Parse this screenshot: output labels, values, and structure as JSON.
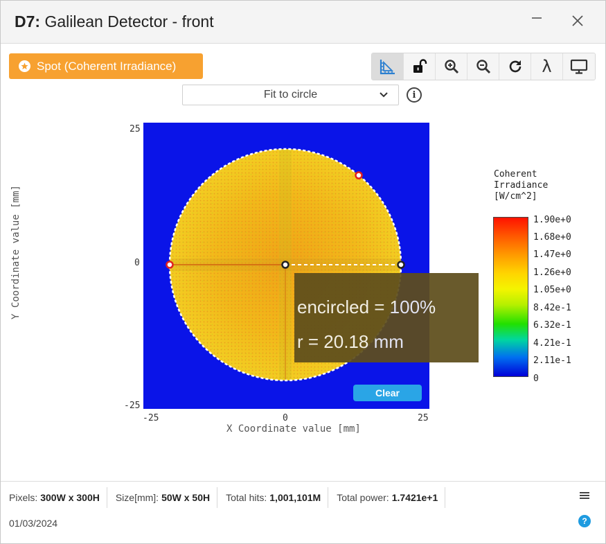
{
  "window": {
    "title_bold": "D7:",
    "title_rest": " Galilean Detector - front"
  },
  "header": {
    "spot_button_label": "Spot (Coherent Irradiance)"
  },
  "toolbar": {
    "icons": [
      "ruler-icon",
      "unlock-icon",
      "zoom-in-icon",
      "zoom-out-icon",
      "refresh-icon",
      "lambda-icon",
      "monitor-icon"
    ],
    "lambda_glyph": "λ"
  },
  "fit": {
    "selected": "Fit to circle",
    "info_glyph": "i"
  },
  "plot": {
    "y_axis_label": "Y Coordinate value [mm]",
    "x_axis_label": "X Coordinate value [mm]",
    "y_ticks": [
      "25",
      "0",
      "-25"
    ],
    "x_ticks": [
      "-25",
      "0",
      "25"
    ],
    "clear_label": "Clear",
    "tooltip_line1": "encircled = 100%",
    "tooltip_line2": "r = 20.18 mm",
    "colors": {
      "background": "#0a14e8",
      "spot": "#f2c11a",
      "accent": "#f7a130"
    }
  },
  "colorbar": {
    "title": "Coherent\nIrradiance\n[W/cm^2]",
    "ticks": [
      "1.90e+0",
      "1.68e+0",
      "1.47e+0",
      "1.26e+0",
      "1.05e+0",
      "8.42e-1",
      "6.32e-1",
      "4.21e-1",
      "2.11e-1",
      "0"
    ]
  },
  "footer": {
    "pixels_label": "Pixels:",
    "pixels_value": "300W x 300H",
    "size_label": "Size[mm]:",
    "size_value": "50W x 50H",
    "hits_label": "Total hits:",
    "hits_value": "1,001,101M",
    "power_label": "Total power:",
    "power_value": "1.7421e+1",
    "date": "01/03/2024",
    "help_glyph": "?"
  }
}
